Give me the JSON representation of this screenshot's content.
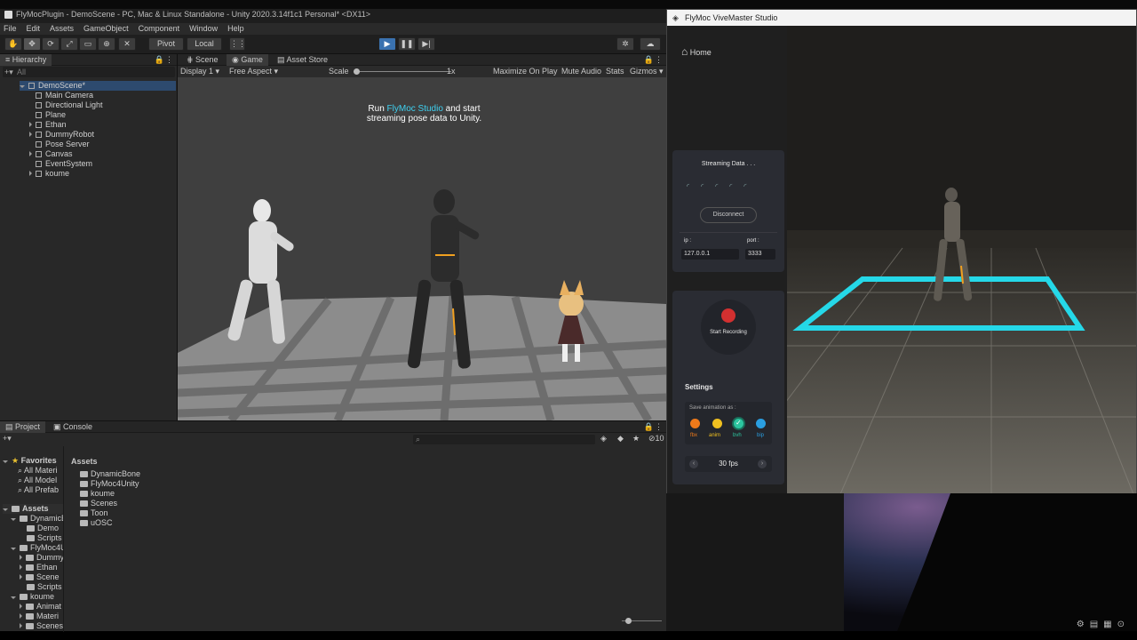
{
  "unity": {
    "title": "FlyMocPlugin - DemoScene - PC, Mac & Linux Standalone - Unity 2020.3.14f1c1 Personal* <DX11>",
    "menu": [
      "File",
      "Edit",
      "Assets",
      "GameObject",
      "Component",
      "Window",
      "Help"
    ],
    "toolbar": {
      "pivot": "Pivot",
      "local": "Local"
    },
    "hierarchy": {
      "tab": "Hierarchy",
      "search_placeholder": "All",
      "scene": "DemoScene*",
      "items": [
        "Main Camera",
        "Directional Light",
        "Plane",
        "Ethan",
        "DummyRobot",
        "Pose Server",
        "Canvas",
        "EventSystem",
        "koume"
      ]
    },
    "game": {
      "tabs": [
        "Scene",
        "Game",
        "Asset Store"
      ],
      "display": "Display 1",
      "aspect": "Free Aspect",
      "scale_label": "Scale",
      "scale_value": "1x",
      "maximize": "Maximize On Play",
      "mute": "Mute Audio",
      "stats": "Stats",
      "gizmos": "Gizmos",
      "overlay_pre": "Run ",
      "overlay_brand": "FlyMoc Studio",
      "overlay_post": " and start streaming pose data to Unity."
    },
    "project": {
      "tabs": [
        "Project",
        "Console"
      ],
      "count": "10",
      "favorites": "Favorites",
      "fav_items": [
        "All Materi",
        "All Model",
        "All Prefab"
      ],
      "assets_root": "Assets",
      "tree": [
        "DynamicE",
        "Demo",
        "Scripts",
        "FlyMoc4U",
        "Dummy",
        "Ethan",
        "Scene",
        "Scripts",
        "koume",
        "Animat",
        "Materi",
        "Scenes"
      ],
      "assets_header": "Assets",
      "folders": [
        "DynamicBone",
        "FlyMoc4Unity",
        "koume",
        "Scenes",
        "Toon",
        "uOSC"
      ]
    }
  },
  "flymoc": {
    "title": "FlyMoc ViveMaster Studio",
    "home": "Home",
    "streaming": "Streaming Data . . .",
    "disconnect": "Disconnect",
    "ip_label": "ip :",
    "ip_value": "127.0.0.1",
    "port_label": "port :",
    "port_value": "3333",
    "record_label": "Start Recording",
    "settings": "Settings",
    "save_as": "Save animation as :",
    "formats": [
      {
        "label": "fbx",
        "color": "#f07a1a"
      },
      {
        "label": "anim",
        "color": "#f0c020"
      },
      {
        "label": "bvh",
        "color": "#2cc6a0"
      },
      {
        "label": "bip",
        "color": "#2a9ee0"
      }
    ],
    "fps": "30 fps"
  }
}
